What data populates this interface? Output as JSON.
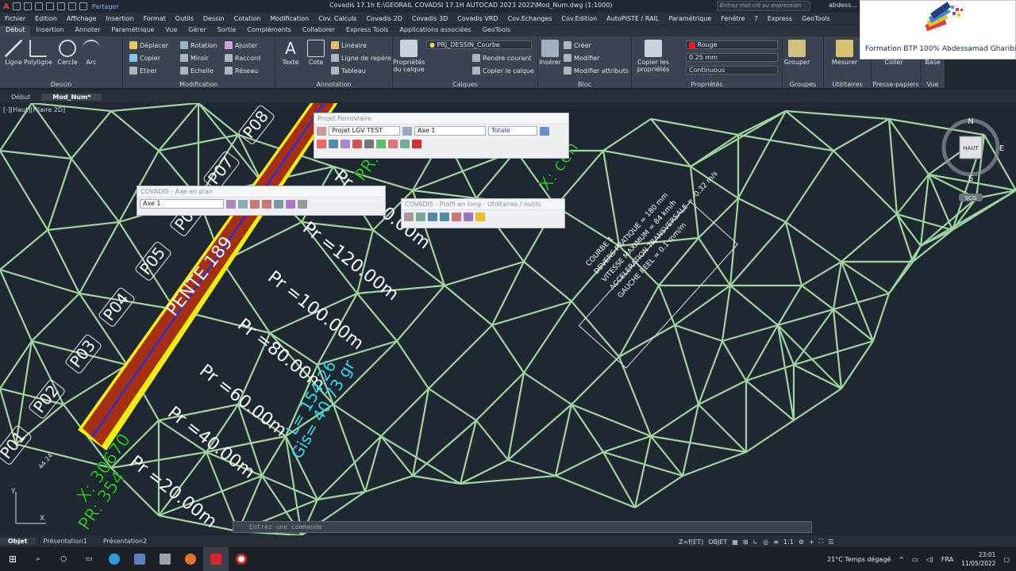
{
  "titlebar": {
    "title": "Covadis 17.1h    E:\\GEORAIL COVADSI 17.1H AUTOCAD 2023 2022\\Mod_Num.dwg (1:1000)",
    "share": "Partager",
    "search_placeholder": "Entrez mot-clé ou expression",
    "user": "abdess..."
  },
  "menubar": [
    "Fichier",
    "Edition",
    "Affichage",
    "Insertion",
    "Format",
    "Outils",
    "Dessin",
    "Cotation",
    "Modification",
    "Cov. Calculs",
    "Covadis 2D",
    "Covadis 3D",
    "Covadis VRD",
    "Cov.Echanges",
    "Cov.Edition",
    "AutoPISTE / RAIL",
    "Paramétrique",
    "Fenêtre",
    "?",
    "Express",
    "GeoTools"
  ],
  "ribbontabs": [
    "Début",
    "Insertion",
    "Annoter",
    "Paramétrique",
    "Vue",
    "Gérer",
    "Sortie",
    "Compléments",
    "Collaborer",
    "Express Tools",
    "Applications associées",
    "GeoTools"
  ],
  "ribbon": {
    "dessin": {
      "label": "Dessin",
      "ligne": "Ligne",
      "polyligne": "Polyligne",
      "cercle": "Cercle",
      "arc": "Arc"
    },
    "modification": {
      "label": "Modification",
      "deplacer": "Déplacer",
      "rotation": "Rotation",
      "ajuster": "Ajuster",
      "copier": "Copier",
      "miroir": "Miroir",
      "raccord": "Raccord",
      "etirer": "Etirer",
      "echelle": "Echelle",
      "reseau": "Réseau"
    },
    "annotation": {
      "label": "Annotation",
      "texte": "Texte",
      "cote": "Cote",
      "lineaire": "Linéaire",
      "ligne_repere": "Ligne de repère",
      "tableau": "Tableau"
    },
    "calques": {
      "label": "Calques",
      "proprietes": "Propriétés du calque",
      "layer": "PRJ_DESSIN_Courbe",
      "rendre_courant": "Rendre courant",
      "copier_calque": "Copier le calque"
    },
    "bloc": {
      "label": "Bloc",
      "inserer": "Insérer",
      "creer": "Créer",
      "modifier": "Modifier",
      "modifier_attributs": "Modifier attributs"
    },
    "proprietes": {
      "label": "Propriétés",
      "copier_props": "Copier les propriétés",
      "color": "Rouge",
      "lineweight": "0.25 mm",
      "linetype": "Continuous"
    },
    "groupes": {
      "label": "Groupes",
      "grouper": "Grouper"
    },
    "utilitaires": {
      "label": "Utilitaires",
      "mesurer": "Mesurer"
    },
    "presse": {
      "label": "Presse-papiers",
      "coller": "Coller"
    },
    "vue": {
      "label": "Vue",
      "base": "Base"
    }
  },
  "logo": {
    "text": "Formation BTP 100% Abdessamad Gharibi"
  },
  "doctabs": [
    "Début",
    "Mod_Num*"
  ],
  "viewport_label": "[-][Haut][Filaire 2D]",
  "viewcube": {
    "n": "N",
    "s": "S",
    "e": "E",
    "face": "HAUT",
    "wcs": "SCG"
  },
  "drawing": {
    "pk_labels": [
      "P01",
      "P02",
      "P03",
      "P04",
      "P05",
      "P06",
      "P07",
      "P08"
    ],
    "pr_labels": [
      "Pr =20.00m",
      "Pr =40.00m",
      "Pr =60.00m",
      "Pr =80.00m",
      "Pr =100.00m",
      "Pr =120.00m",
      "Pr =140.00m"
    ],
    "pente": "PENTE 189",
    "cyan_l": "L= 154.26",
    "cyan_gis": "Gis= 40.73 gr",
    "green_x": "X: 30670",
    "green_pr": "PR: 354",
    "green_top1": "PR: 355",
    "green_top2": "X: cen",
    "box": [
      "COURBE 1",
      "DEVERS PRATIQUE = 180 mm",
      "VITESSE MAXIMUM = 84 km/h",
      "ACCELERATION TRANSVERSALE = -0.32 m/s",
      "GAUCHE REEL = 0.1 mm/m"
    ],
    "angle": "44.24"
  },
  "palettes": {
    "ferroviaire": {
      "title": "Projet Ferroviaire",
      "projet": "Projet LGV TEST",
      "axe": "Axe 1",
      "mode": "Totale"
    },
    "axe_plan": {
      "title": "COVADIS - Axe en plan",
      "axe": "Axe 1"
    },
    "profil": {
      "title": "COVADIS - Profil en long - Utilitaires / outils"
    }
  },
  "command": {
    "placeholder": "Entrez une commande"
  },
  "layouttabs": [
    "Objet",
    "Présentation1",
    "Présentation2"
  ],
  "status": {
    "z": "Z=f(ET)",
    "objet": "OBJET",
    "scale": "1:1"
  },
  "taskbar": {
    "weather": "21°C  Temps dégagé",
    "lang": "FRA",
    "time": "23:01",
    "date": "11/05/2022"
  }
}
